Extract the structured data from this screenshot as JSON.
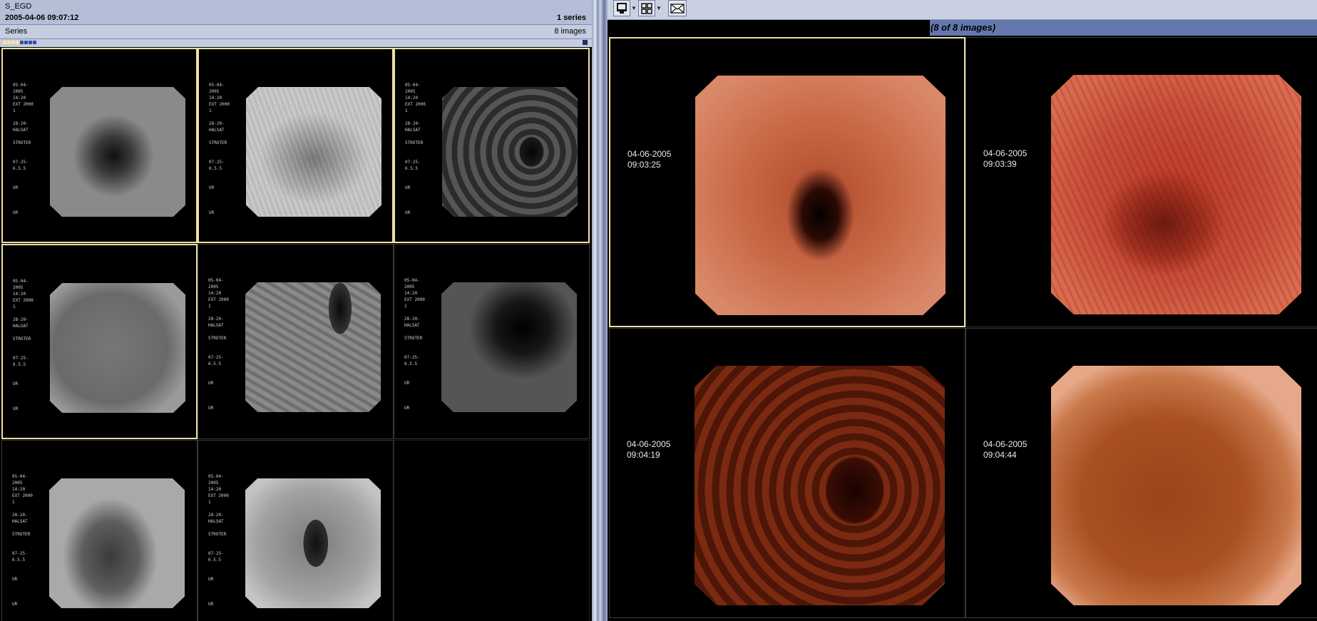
{
  "left_panel": {
    "study_name": "S_EGD",
    "study_datetime": "2005-04-06 09:07:12",
    "series_count": "1 series",
    "series_label": "Series",
    "image_count": "8 images",
    "thumb_overlay_lines": [
      "05-04-2005",
      "14:20",
      "EXT 2000",
      "1",
      "",
      "28-20-",
      "HALSAT",
      "",
      "STROTER",
      "",
      "",
      "07-25-",
      "6.5.5",
      "",
      "",
      "UR"
    ]
  },
  "right_panel": {
    "image_count_label": "(8 of 8 images)",
    "tiles": [
      {
        "date": "04-06-2005",
        "time": "09:03:25"
      },
      {
        "date": "04-06-2005",
        "time": "09:03:39"
      },
      {
        "date": "04-06-2005",
        "time": "09:04:19"
      },
      {
        "date": "04-06-2005",
        "time": "09:04:44"
      }
    ]
  },
  "icons": [
    "monitor-icon",
    "grid-layout-icon",
    "envelope-icon",
    "dropdown-arrow-icon"
  ],
  "colors": {
    "header_bg": "#b4bed6",
    "title_bar": "#6478ae",
    "selection_border": "#efe0a8"
  }
}
